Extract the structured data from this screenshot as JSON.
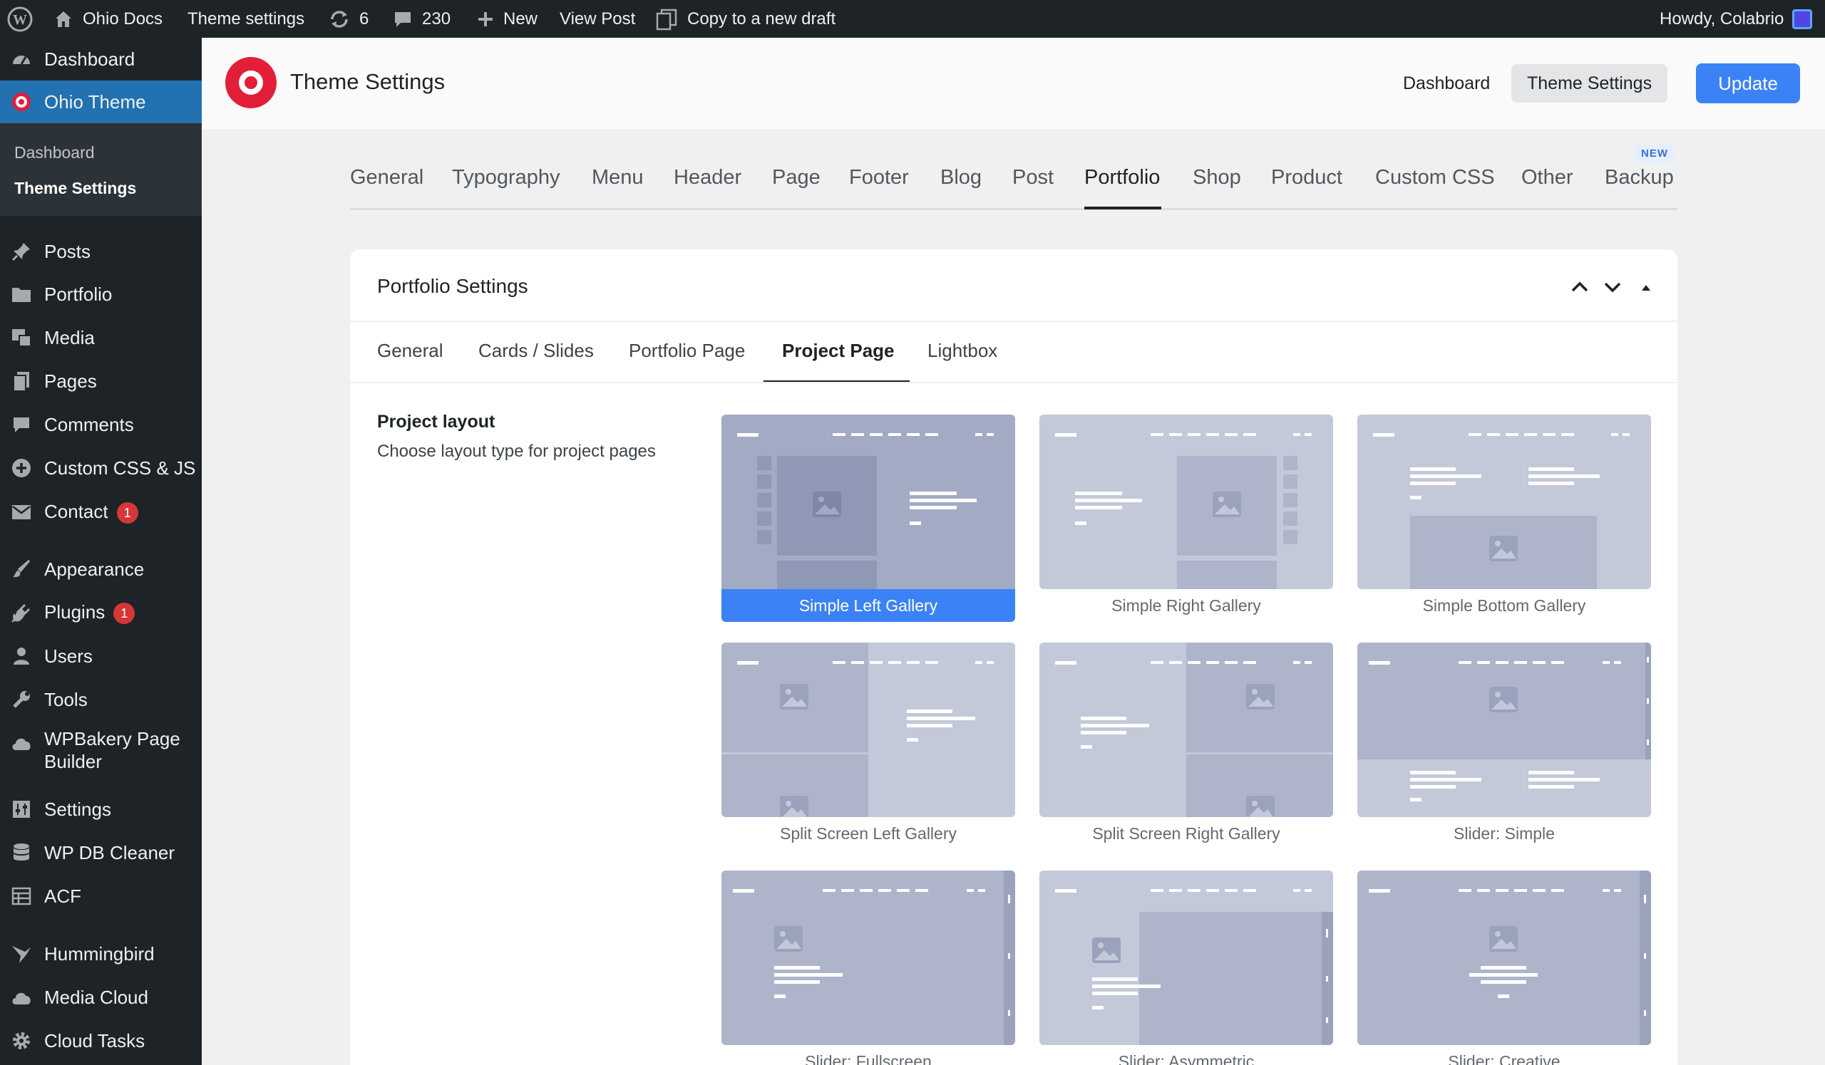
{
  "admin_bar": {
    "site_name": "Ohio Docs",
    "theme_settings": "Theme settings",
    "updates": "6",
    "comments": "230",
    "new": "New",
    "view_post": "View Post",
    "copy_draft": "Copy to a new draft",
    "greeting": "Howdy, Colabrio"
  },
  "sidebar": {
    "items": [
      {
        "label": "Dashboard",
        "icon": "dashboard-icon"
      },
      {
        "label": "Ohio Theme",
        "icon": "ohio-logo-icon"
      },
      {
        "label": "Posts",
        "icon": "pin-icon"
      },
      {
        "label": "Portfolio",
        "icon": "folder-icon"
      },
      {
        "label": "Media",
        "icon": "media-icon"
      },
      {
        "label": "Pages",
        "icon": "pages-icon"
      },
      {
        "label": "Comments",
        "icon": "comment-icon"
      },
      {
        "label": "Custom CSS & JS",
        "icon": "plus-circle-icon"
      },
      {
        "label": "Contact",
        "icon": "mail-icon",
        "badge": "1"
      },
      {
        "label": "Appearance",
        "icon": "brush-icon"
      },
      {
        "label": "Plugins",
        "icon": "plug-icon",
        "badge": "1"
      },
      {
        "label": "Users",
        "icon": "user-icon"
      },
      {
        "label": "Tools",
        "icon": "wrench-icon"
      },
      {
        "label": "WPBakery Page",
        "label2": "Builder",
        "icon": "cloud-icon"
      },
      {
        "label": "Settings",
        "icon": "sliders-icon"
      },
      {
        "label": "WP DB Cleaner",
        "icon": "database-icon"
      },
      {
        "label": "ACF",
        "icon": "table-icon"
      },
      {
        "label": "Hummingbird",
        "icon": "hummingbird-icon"
      },
      {
        "label": "Media Cloud",
        "icon": "cloud-icon"
      },
      {
        "label": "Cloud Tasks",
        "icon": "gear-icon"
      }
    ],
    "submenu": [
      "Dashboard",
      "Theme Settings"
    ]
  },
  "header": {
    "title": "Theme Settings",
    "links": [
      "Dashboard",
      "Theme Settings"
    ],
    "update": "Update"
  },
  "tabs": {
    "items": [
      "General",
      "Typography",
      "Menu",
      "Header",
      "Page",
      "Footer",
      "Blog",
      "Post",
      "Portfolio",
      "Shop",
      "Product",
      "Custom CSS",
      "Other",
      "Backup"
    ],
    "active": "Portfolio",
    "new_badge": "NEW"
  },
  "panel": {
    "title": "Portfolio Settings",
    "subtabs": [
      "General",
      "Cards / Slides",
      "Portfolio Page",
      "Project Page",
      "Lightbox"
    ],
    "active_subtab": "Project Page",
    "field_label": "Project layout",
    "field_desc": "Choose layout type for project pages",
    "layouts": [
      "Simple Left Gallery",
      "Simple Right Gallery",
      "Simple Bottom Gallery",
      "Split Screen Left Gallery",
      "Split Screen Right Gallery",
      "Slider: Simple",
      "Slider: Fullscreen",
      "Slider: Asymmetric",
      "Slider: Creative"
    ],
    "selected_layout": "Simple Left Gallery"
  },
  "colors": {
    "accent": "#3b82f6",
    "admin_bar": "#1d2327",
    "sidebar_current": "#2271b1",
    "logo": "#e31e38",
    "badge": "#d63638"
  }
}
